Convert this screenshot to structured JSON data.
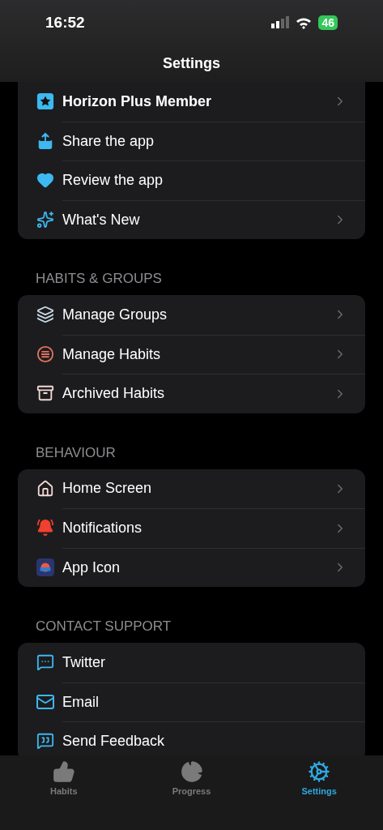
{
  "status_bar": {
    "time": "16:52",
    "battery": "46"
  },
  "header": {
    "title": "Settings"
  },
  "sections": [
    {
      "items": [
        {
          "label": "Horizon Plus Member",
          "bold": true,
          "chevron": true
        },
        {
          "label": "Share the app",
          "bold": false,
          "chevron": false
        },
        {
          "label": "Review the app",
          "bold": false,
          "chevron": false
        },
        {
          "label": "What's New",
          "bold": false,
          "chevron": true
        }
      ]
    },
    {
      "title": "HABITS & GROUPS",
      "items": [
        {
          "label": "Manage Groups",
          "bold": false,
          "chevron": true
        },
        {
          "label": "Manage Habits",
          "bold": false,
          "chevron": true
        },
        {
          "label": "Archived Habits",
          "bold": false,
          "chevron": true
        }
      ]
    },
    {
      "title": "BEHAVIOUR",
      "items": [
        {
          "label": "Home Screen",
          "bold": false,
          "chevron": true
        },
        {
          "label": "Notifications",
          "bold": false,
          "chevron": true
        },
        {
          "label": "App Icon",
          "bold": false,
          "chevron": true
        }
      ]
    },
    {
      "title": "CONTACT SUPPORT",
      "items": [
        {
          "label": "Twitter",
          "bold": false,
          "chevron": false
        },
        {
          "label": "Email",
          "bold": false,
          "chevron": false
        },
        {
          "label": "Send Feedback",
          "bold": false,
          "chevron": false
        }
      ]
    }
  ],
  "tab_bar": [
    {
      "label": "Habits",
      "selected": false
    },
    {
      "label": "Progress",
      "selected": false
    },
    {
      "label": "Settings",
      "selected": true
    }
  ]
}
